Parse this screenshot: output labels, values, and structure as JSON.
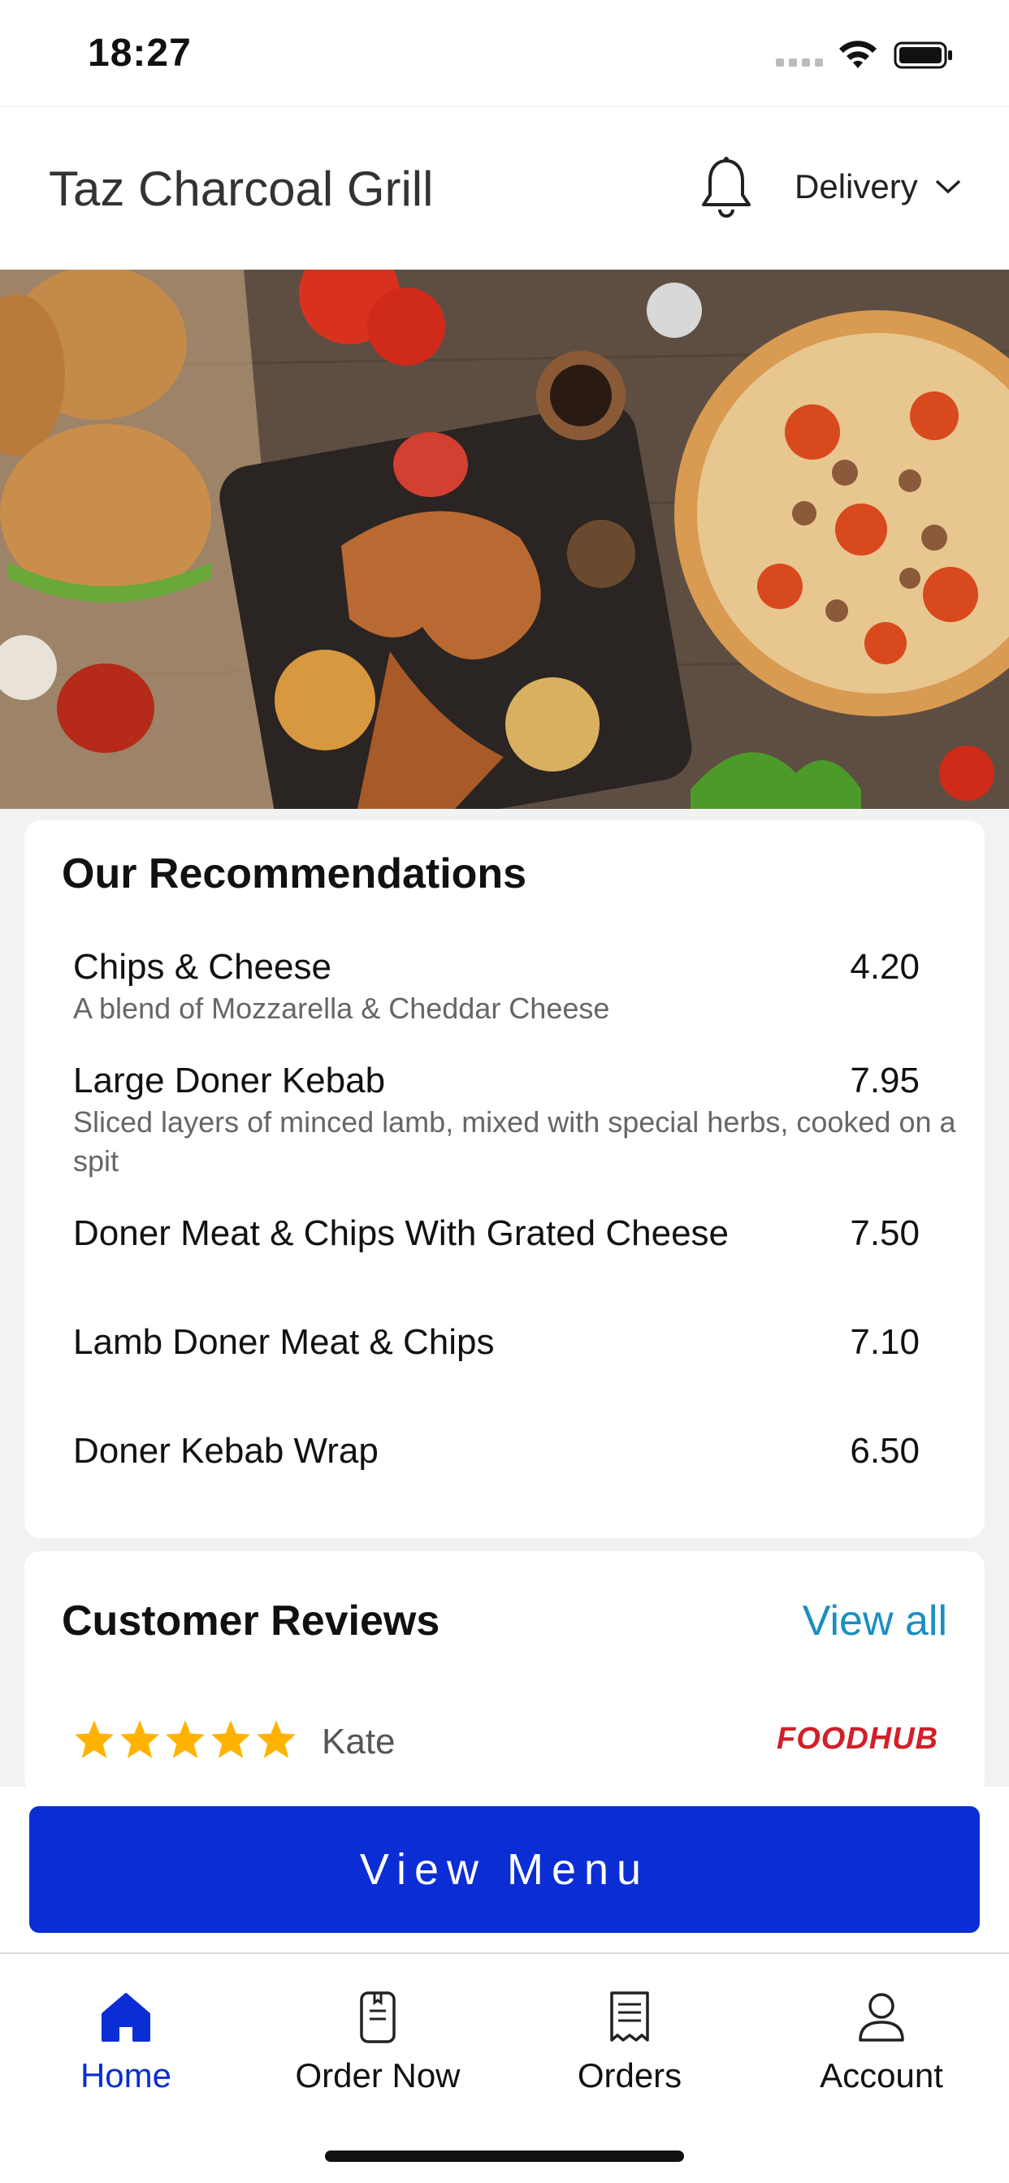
{
  "status_bar": {
    "time": "18:27"
  },
  "header": {
    "store_name": "Taz Charcoal Grill",
    "mode": "Delivery"
  },
  "hero": {
    "icon": "food-photo"
  },
  "recommendations": {
    "title": "Our Recommendations",
    "items": [
      {
        "name": "Chips & Cheese",
        "price": "4.20",
        "desc": "A blend of Mozzarella & Cheddar Cheese"
      },
      {
        "name": "Large Doner Kebab",
        "price": "7.95",
        "desc": "Sliced layers of minced lamb, mixed with special herbs, cooked on a spit"
      },
      {
        "name": "Doner Meat & Chips With Grated Cheese",
        "price": "7.50",
        "desc": ""
      },
      {
        "name": "Lamb Doner Meat & Chips",
        "price": "7.10",
        "desc": ""
      },
      {
        "name": "Doner Kebab Wrap",
        "price": "6.50",
        "desc": ""
      }
    ]
  },
  "reviews": {
    "title": "Customer Reviews",
    "view_all": "View all",
    "first": {
      "rating": 5,
      "name": "Kate",
      "source": "FOODHUB"
    }
  },
  "cta": {
    "label": "View Menu"
  },
  "tabs": [
    {
      "label": "Home",
      "icon": "home-icon",
      "active": true
    },
    {
      "label": "Order Now",
      "icon": "order-icon",
      "active": false
    },
    {
      "label": "Orders",
      "icon": "receipt-icon",
      "active": false
    },
    {
      "label": "Account",
      "icon": "user-icon",
      "active": false
    }
  ],
  "colors": {
    "primary": "#0a2ed4",
    "link": "#1a8fc0",
    "star": "#ffb300",
    "foodhub": "#d0202a"
  }
}
